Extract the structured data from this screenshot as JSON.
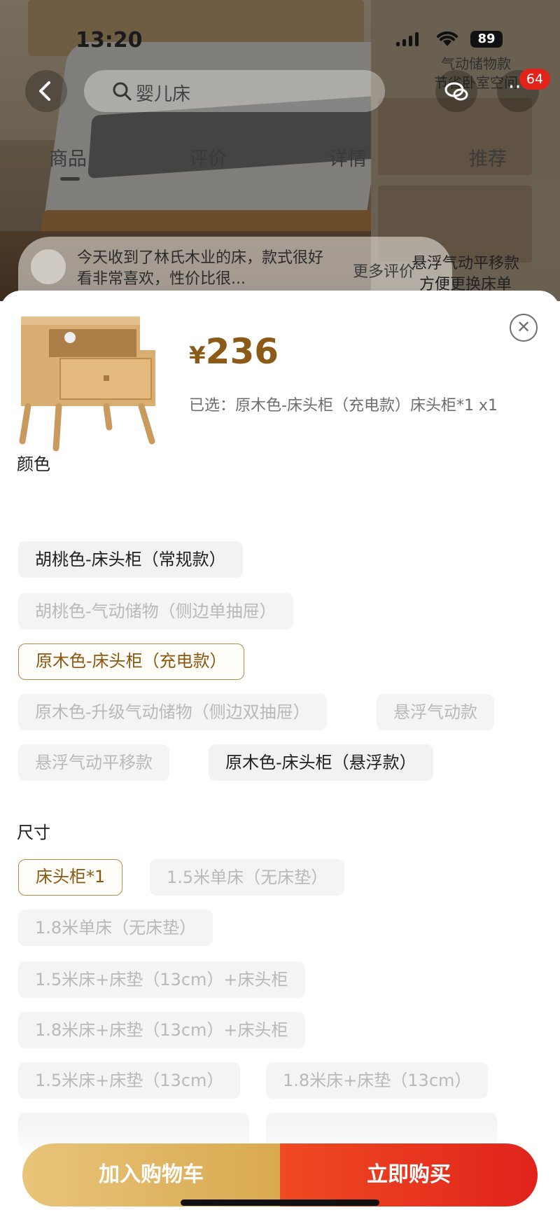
{
  "status_bar": {
    "time": "13:20",
    "battery": "89"
  },
  "header": {
    "search_placeholder": "婴儿床",
    "side_promo_top": "气动储物款\n节省卧室空间",
    "cart_count": "64"
  },
  "tabs": [
    {
      "label": "商品"
    },
    {
      "label": "评价"
    },
    {
      "label": "详情"
    },
    {
      "label": "推荐"
    }
  ],
  "review": {
    "text": "今天收到了林氏木业的床，款式很好看非常喜欢，性价比很...",
    "more": "更多评价",
    "side_promo": "悬浮气动平移款\n方便更换床单"
  },
  "sheet": {
    "price_symbol": "¥",
    "price": "236",
    "selected": "已选：原木色-床头柜（充电款）床头柜*1 x1",
    "color_title": "颜色",
    "color_options": [
      {
        "label": "胡桃色-床头柜（常规款）",
        "state": "normal"
      },
      {
        "label": "胡桃色-气动储物（侧边单抽屉）",
        "state": "disabled"
      },
      {
        "label": "原木色-床头柜（充电款）",
        "state": "selected"
      },
      {
        "label": "原木色-升级气动储物（侧边双抽屉）",
        "state": "disabled"
      },
      {
        "label": "悬浮气动款",
        "state": "disabled"
      },
      {
        "label": "悬浮气动平移款",
        "state": "disabled"
      },
      {
        "label": "原木色-床头柜（悬浮款）",
        "state": "normal"
      }
    ],
    "size_title": "尺寸",
    "size_options": [
      {
        "label": "床头柜*1",
        "state": "selected"
      },
      {
        "label": "1.5米单床（无床垫）",
        "state": "disabled"
      },
      {
        "label": "1.8米单床（无床垫）",
        "state": "disabled"
      },
      {
        "label": "1.5米床+床垫（13cm）+床头柜",
        "state": "disabled"
      },
      {
        "label": "1.8米床+床垫（13cm）+床头柜",
        "state": "disabled"
      },
      {
        "label": "1.5米床+床垫（13cm）",
        "state": "disabled"
      },
      {
        "label": "1.8米床+床垫（13cm）",
        "state": "disabled"
      }
    ]
  },
  "actions": {
    "add_to_cart": "加入购物车",
    "buy_now": "立即购买"
  },
  "colors": {
    "price": "#8a5a16",
    "selected_border": "#b48a52",
    "buy": "#e0231b",
    "cart": "#d9a94f"
  }
}
